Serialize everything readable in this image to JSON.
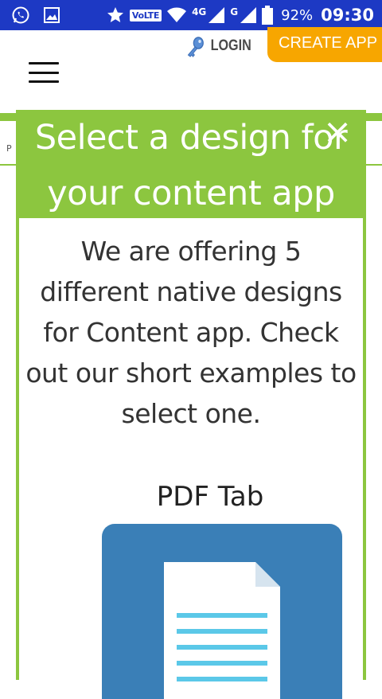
{
  "status_bar": {
    "volte": "VoLTE",
    "network_4g": "4G",
    "network_g": "G",
    "battery": "92%",
    "time": "09:30"
  },
  "header": {
    "login_label": "LOGIN",
    "create_app_label": "CREATE APP"
  },
  "page": {
    "peek_text": "P"
  },
  "modal": {
    "title_line1": "Select a design for",
    "title_line2": "your content app",
    "close_glyph": "×",
    "description": "We are offering 5 different native designs for Content app. Check out our short examples to select one.",
    "design_title": "PDF Tab"
  },
  "colors": {
    "status_bar": "#1d39c4",
    "accent_green": "#8cc63f",
    "create_app": "#f7a600",
    "card_blue": "#3a7fb7",
    "doc_lines": "#5bc8e8"
  },
  "icons": {
    "status_left": [
      "whatsapp-icon",
      "gallery-icon"
    ],
    "status_right": [
      "star-icon",
      "wifi-icon",
      "signal-icon",
      "battery-icon"
    ],
    "login": "key-icon",
    "menu": "hamburger-menu-icon",
    "close": "close-icon",
    "design": "document-icon"
  }
}
